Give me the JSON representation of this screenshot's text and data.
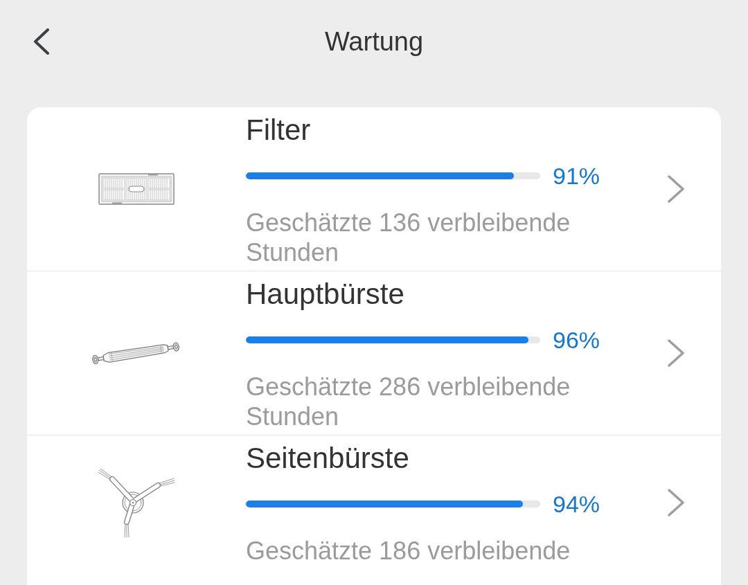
{
  "header": {
    "title": "Wartung"
  },
  "items": [
    {
      "kind": "filter",
      "name": "Filter",
      "level": 0.91,
      "percent": "91%",
      "estimate": "Geschätzte 136 verbleibende Stunden"
    },
    {
      "kind": "main_brush",
      "name": "Hauptbürste",
      "level": 0.96,
      "percent": "96%",
      "estimate": "Geschätzte 286 verbleibende Stunden"
    },
    {
      "kind": "side_brush",
      "name": "Seitenbürste",
      "level": 0.94,
      "percent": "94%",
      "estimate": "Geschätzte 186 verbleibende"
    }
  ]
}
